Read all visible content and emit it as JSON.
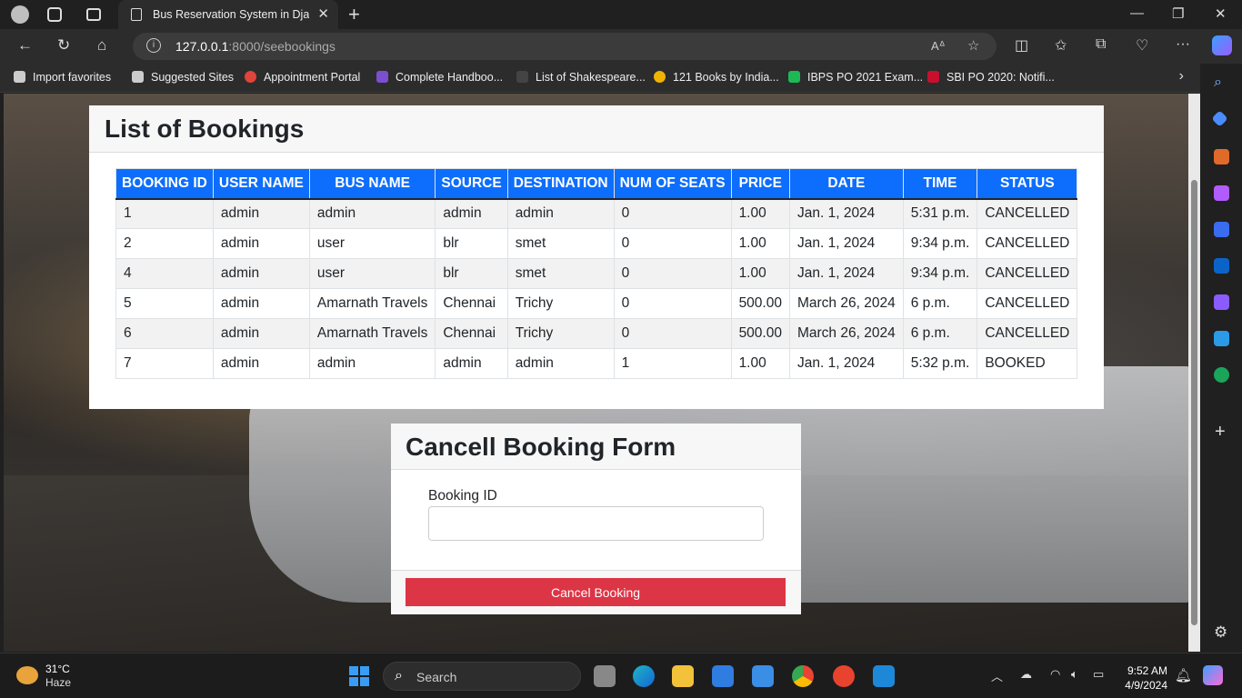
{
  "browser": {
    "tab_title": "Bus Reservation System in Djang",
    "url_host": "127.0.0.1",
    "url_rest": ":8000/seebookings",
    "favorites": [
      {
        "label": "Import favorites",
        "color": "#cccccc"
      },
      {
        "label": "Suggested Sites",
        "color": "#cccccc"
      },
      {
        "label": "Appointment Portal",
        "color": "#e0443a"
      },
      {
        "label": "Complete Handboo...",
        "color": "#7b4fd0"
      },
      {
        "label": "List of Shakespeare...",
        "color": "#444444"
      },
      {
        "label": "121 Books by India...",
        "color": "#f0b400"
      },
      {
        "label": "IBPS PO 2021 Exam...",
        "color": "#1db954"
      },
      {
        "label": "SBI PO 2020: Notifi...",
        "color": "#c8102e"
      }
    ]
  },
  "bookings": {
    "title": "List of Bookings",
    "columns": [
      "BOOKING ID",
      "USER NAME",
      "BUS NAME",
      "SOURCE",
      "DESTINATION",
      "NUM OF SEATS",
      "PRICE",
      "DATE",
      "TIME",
      "STATUS"
    ],
    "rows": [
      [
        "1",
        "admin",
        "admin",
        "admin",
        "admin",
        "0",
        "1.00",
        "Jan. 1, 2024",
        "5:31 p.m.",
        "CANCELLED"
      ],
      [
        "2",
        "admin",
        "user",
        "blr",
        "smet",
        "0",
        "1.00",
        "Jan. 1, 2024",
        "9:34 p.m.",
        "CANCELLED"
      ],
      [
        "4",
        "admin",
        "user",
        "blr",
        "smet",
        "0",
        "1.00",
        "Jan. 1, 2024",
        "9:34 p.m.",
        "CANCELLED"
      ],
      [
        "5",
        "admin",
        "Amarnath Travels",
        "Chennai",
        "Trichy",
        "0",
        "500.00",
        "March 26, 2024",
        "6 p.m.",
        "CANCELLED"
      ],
      [
        "6",
        "admin",
        "Amarnath Travels",
        "Chennai",
        "Trichy",
        "0",
        "500.00",
        "March 26, 2024",
        "6 p.m.",
        "CANCELLED"
      ],
      [
        "7",
        "admin",
        "admin",
        "admin",
        "admin",
        "1",
        "1.00",
        "Jan. 1, 2024",
        "5:32 p.m.",
        "BOOKED"
      ]
    ]
  },
  "cancel_form": {
    "title": "Cancell Booking Form",
    "field_label": "Booking ID",
    "field_value": "",
    "button_label": "Cancel Booking"
  },
  "taskbar": {
    "temperature": "31°C",
    "condition": "Haze",
    "search_label": "Search",
    "time": "9:52 AM",
    "date": "4/9/2024"
  },
  "colors": {
    "primary": "#0d6efd",
    "danger": "#dc3545"
  }
}
